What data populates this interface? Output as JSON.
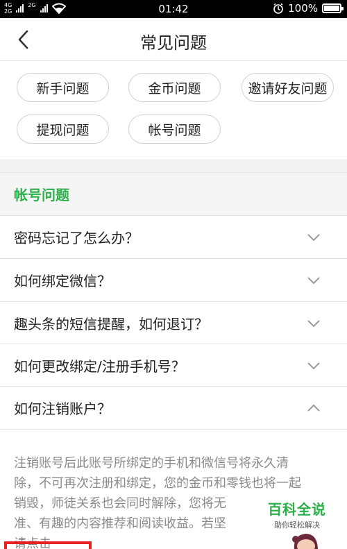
{
  "status_bar": {
    "network_top": "4G",
    "network_bottom": "2G",
    "network_mid": "2G",
    "time": "01:42",
    "battery": "100%"
  },
  "header": {
    "title": "常见问题"
  },
  "categories": [
    "新手问题",
    "金币问题",
    "邀请好友问题",
    "提现问题",
    "帐号问题"
  ],
  "section": {
    "title": "帐号问题"
  },
  "faq": [
    {
      "question": "密码忘记了怎么办？",
      "expanded": false
    },
    {
      "question": "如何绑定微信？",
      "expanded": false
    },
    {
      "question": "趣头条的短信提醒，如何退订？",
      "expanded": false
    },
    {
      "question": "如何更改绑定/注册手机号？",
      "expanded": false
    },
    {
      "question": "如何注销账户？",
      "expanded": true
    }
  ],
  "answer": {
    "lines": [
      "注销账号后此账号所绑定的手机和微信号将永久清",
      "除，不可再次注册和绑定，您的金币和零钱也将一起",
      "销毁，师徒关系也会同时解除，您将无",
      "准、有趣的内容推荐和阅读收益。若坚",
      "请点击"
    ]
  },
  "watermark": {
    "title": "百科全说",
    "subtitle": "助你轻松解决"
  },
  "colors": {
    "accent": "#2db04b",
    "highlight": "#e8201f"
  }
}
